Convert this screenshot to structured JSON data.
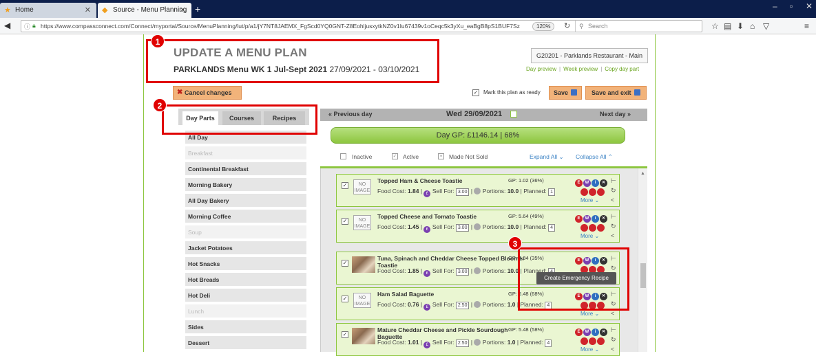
{
  "browser": {
    "tabs": [
      {
        "label": "Home"
      },
      {
        "label": "Source - Menu Planning"
      }
    ],
    "url": "https://www.compassconnect.com/Connect/myportal/Source/MenuPlanning/lut/p/a1/jY7NT8JAEMX_FgScd0YQ0GNT-Z8EohljusxytkNZ0v1Iu67439v1oCeqc5k3yXu_eaBgB8pS1BUF7Sz",
    "zoom": "120%",
    "search_placeholder": "Search"
  },
  "header": {
    "title": "UPDATE A MENU PLAN",
    "menu_name": "PARKLANDS Menu WK 1 Jul-Sept 2021",
    "date_range": "27/09/2021 - 03/10/2021",
    "site": "G20201 - Parklands Restaurant - Main",
    "links": [
      "Day preview",
      "Week preview",
      "Copy day part"
    ]
  },
  "toolbar": {
    "cancel_label": "Cancel changes",
    "ready_label": "Mark this plan as ready",
    "save_label": "Save",
    "save_exit_label": "Save and exit"
  },
  "left_tabs": [
    "Day Parts",
    "Courses",
    "Recipes"
  ],
  "day_parts": [
    {
      "label": "All Day",
      "dim": false
    },
    {
      "label": "Breakfast",
      "dim": true
    },
    {
      "label": "Continental Breakfast",
      "dim": false
    },
    {
      "label": "Morning Bakery",
      "dim": false
    },
    {
      "label": "All Day Bakery",
      "dim": false
    },
    {
      "label": "Morning Coffee",
      "dim": false
    },
    {
      "label": "Soup",
      "dim": true
    },
    {
      "label": "Jacket Potatoes",
      "dim": false
    },
    {
      "label": "Hot Snacks",
      "dim": false
    },
    {
      "label": "Hot Breads",
      "dim": false
    },
    {
      "label": "Hot Deli",
      "dim": false
    },
    {
      "label": "Lunch",
      "dim": true
    },
    {
      "label": "Sides",
      "dim": false
    },
    {
      "label": "Dessert",
      "dim": false
    }
  ],
  "day_nav": {
    "prev": "« Previous day",
    "current": "Wed 29/09/2021",
    "next": "Next day »"
  },
  "day_gp": "Day GP: £1146.14  |  68%",
  "filters": {
    "inactive": "Inactive",
    "active": "Active",
    "made_not_sold": "Made Not Sold",
    "expand": "Expand All",
    "collapse": "Collapse All"
  },
  "no_image_label": "NO IMAGE",
  "recipe_labels": {
    "food_cost": "Food Cost:",
    "sell_for": "Sell For:",
    "portions": "Portions:",
    "planned": "Planned:",
    "more": "More"
  },
  "recipes": [
    {
      "name": "Topped Ham & Cheese Toastie",
      "gp": "GP: 1.02 (36%)",
      "food_cost": "1.84",
      "sell_for": "3.00",
      "portions": "10.0",
      "planned": "1",
      "image": false
    },
    {
      "name": "Topped Cheese and Tomato Toastie",
      "gp": "GP: 5.64 (49%)",
      "food_cost": "1.45",
      "sell_for": "3.00",
      "portions": "10.0",
      "planned": "4",
      "image": false
    },
    {
      "name": "Tuna, Spinach and Cheddar Cheese Topped Bloomer",
      "name2": "Toastie",
      "gp": "GP: 4.04 (35%)",
      "food_cost": "1.85",
      "sell_for": "3.00",
      "portions": "10.0",
      "planned": "4",
      "image": true
    },
    {
      "name": "Ham Salad Baguette",
      "gp": "GP: 6.48 (68%)",
      "food_cost": "0.76",
      "sell_for": "2.50",
      "portions": "1.0",
      "planned": "4",
      "image": false
    },
    {
      "name": "Mature Cheddar Cheese and Pickle Sourdough",
      "name2": "Baguette",
      "gp": "GP: 5.48 (58%)",
      "food_cost": "1.01",
      "sell_for": "2.50",
      "portions": "1.0",
      "planned": "4",
      "image": true
    }
  ],
  "tooltip": "Create Emergency Recipe",
  "annotations": [
    "1",
    "2",
    "3"
  ],
  "colors": {
    "accent_green": "#8dc63f",
    "button_orange": "#f2b37a",
    "annotation_red": "#e00000",
    "link_blue": "#3b82c4"
  }
}
